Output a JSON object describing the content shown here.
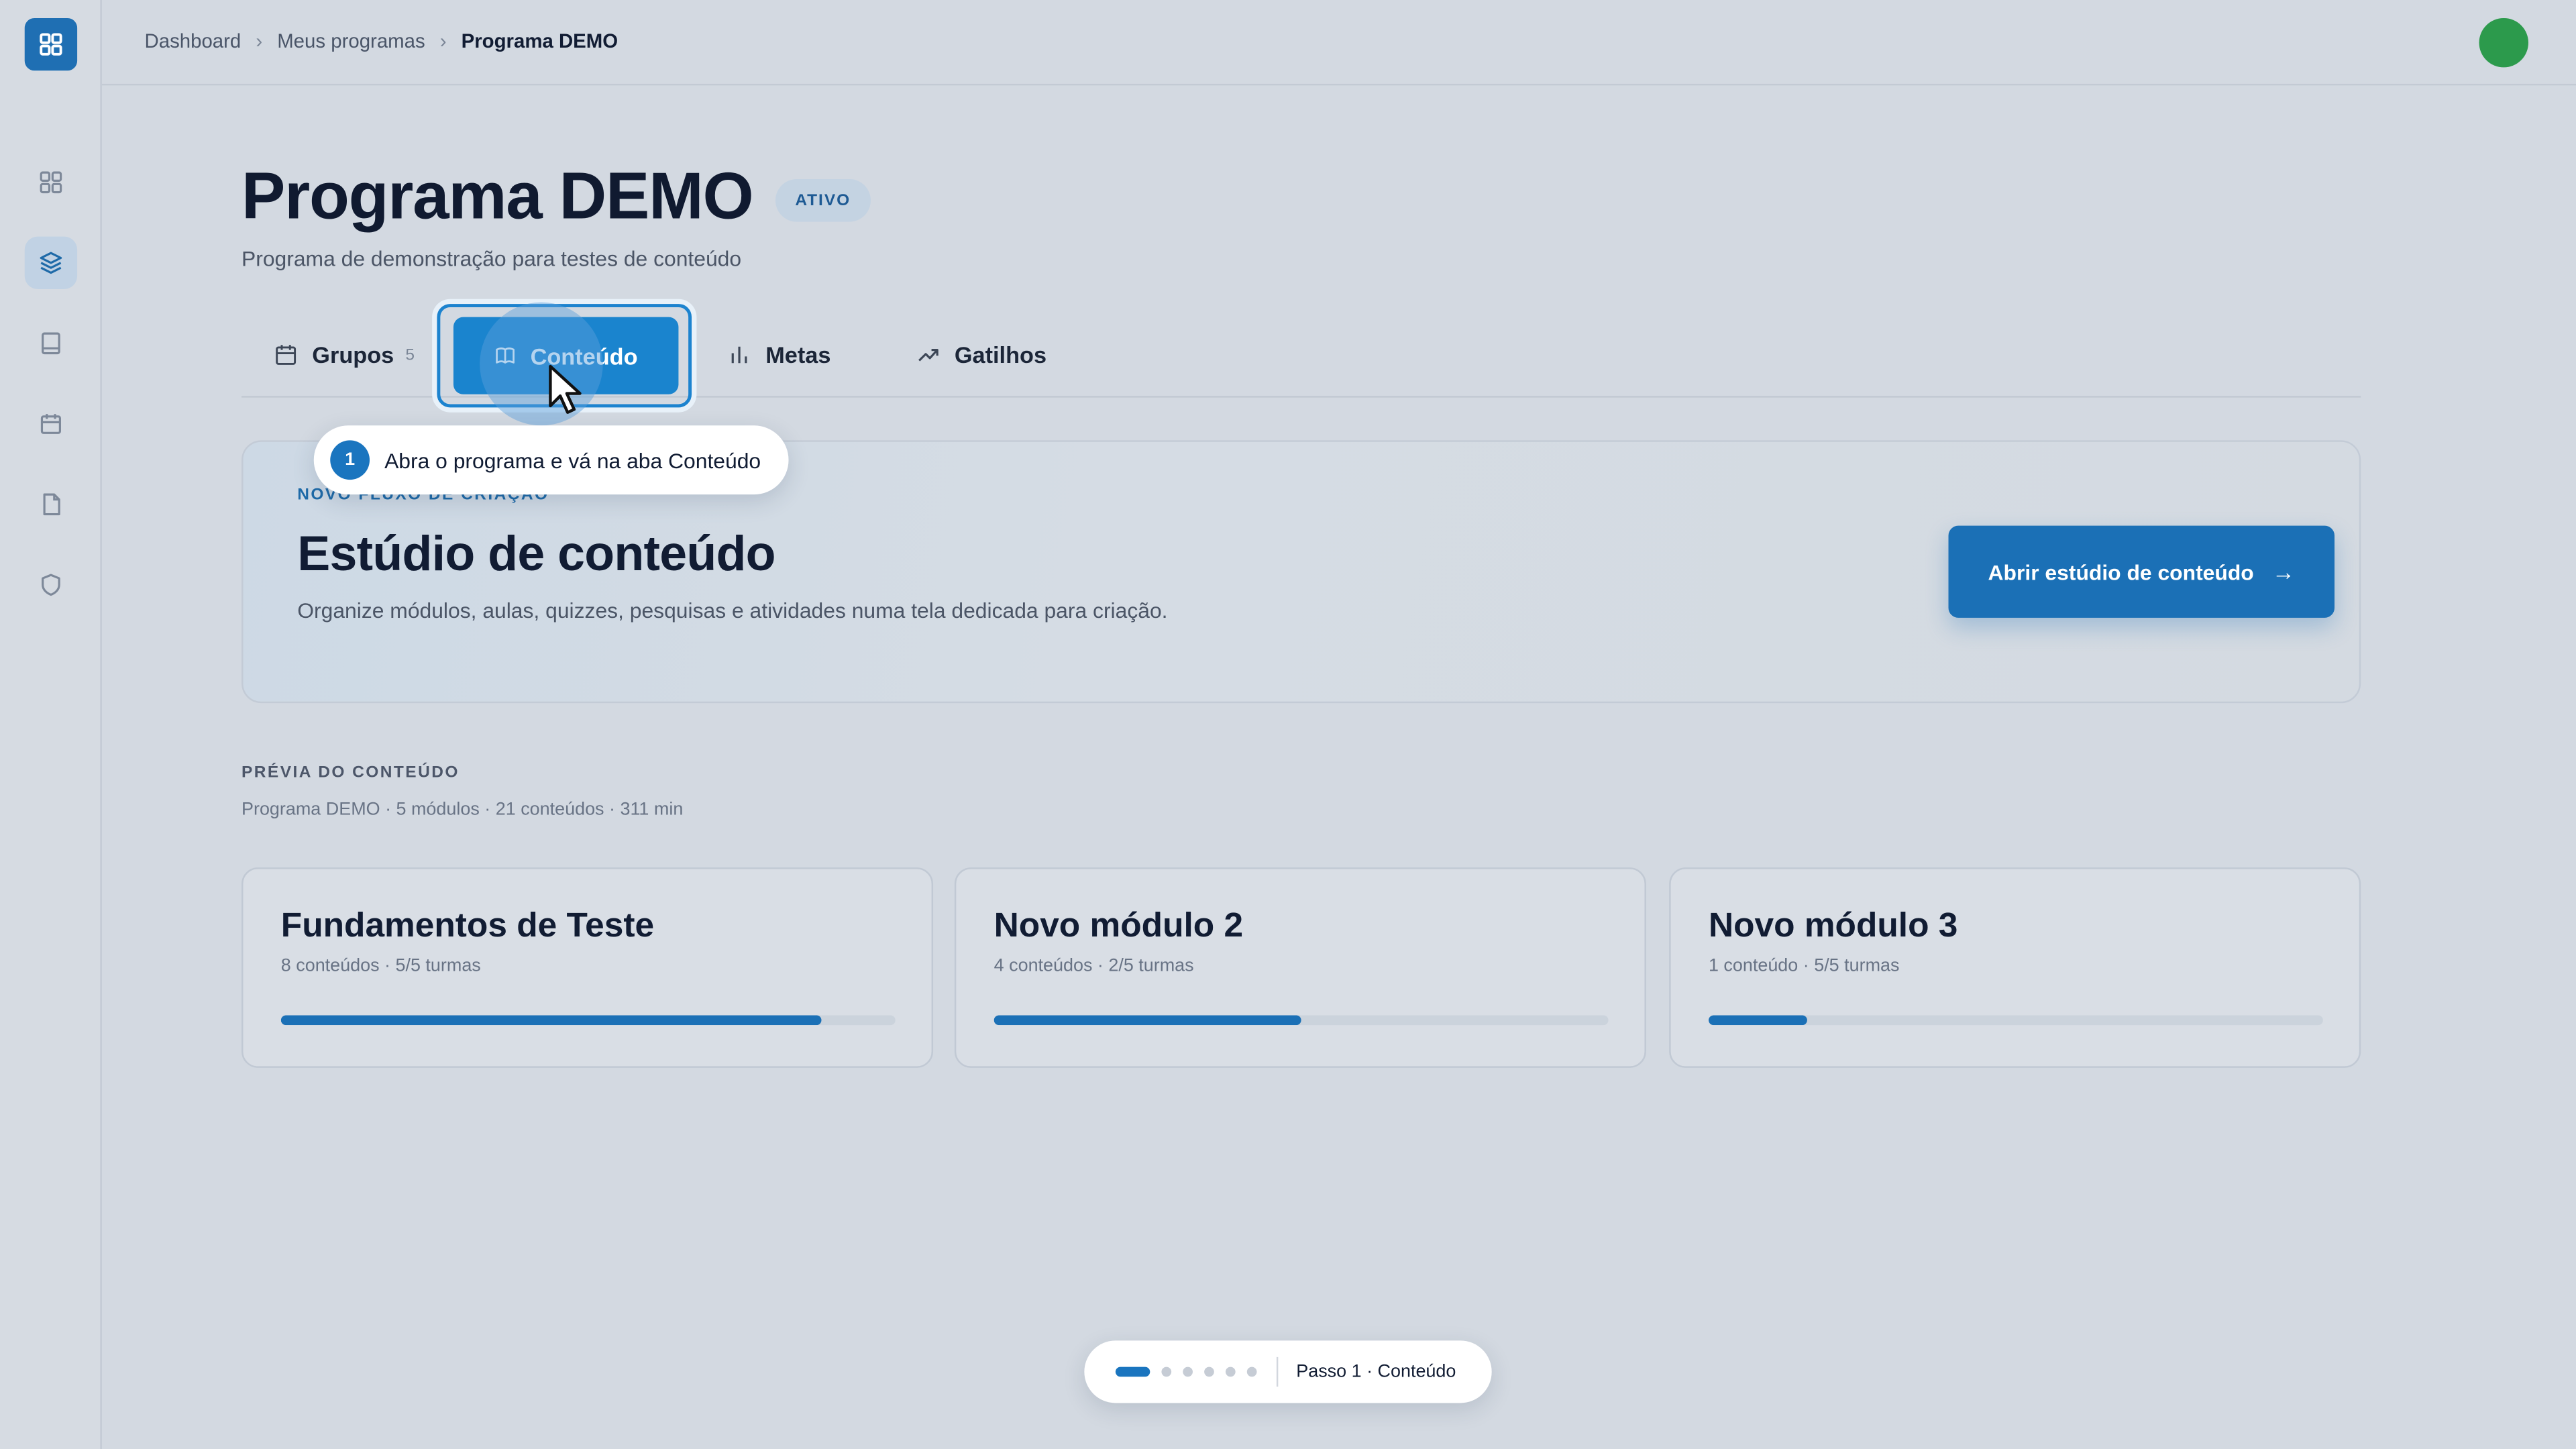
{
  "breadcrumb": {
    "items": [
      "Dashboard",
      "Meus programas"
    ],
    "current": "Programa DEMO",
    "separator": ">"
  },
  "sidebar": {
    "icons": [
      "grid-icon",
      "layers-icon",
      "book-icon",
      "calendar-icon",
      "file-icon",
      "shield-icon"
    ],
    "active": "layers-icon"
  },
  "program": {
    "title": "Programa DEMO",
    "status": "ATIVO",
    "subtitle": "Programa de demonstração para testes de conteúdo"
  },
  "tabs": [
    {
      "label": "Grupos",
      "count": "5",
      "icon": "calendar-icon"
    },
    {
      "label": "Conteúdo",
      "icon": "book-open-icon",
      "active": true
    },
    {
      "label": "Metas",
      "icon": "bar-chart-icon"
    },
    {
      "label": "Gatilhos",
      "icon": "trending-up-icon"
    }
  ],
  "tooltip": {
    "step": "1",
    "text": "Abra o programa e vá na aba Conteúdo"
  },
  "studio": {
    "eyebrow": "NOVO FLUXO DE CRIAÇÃO",
    "title": "Estúdio de conteúdo",
    "description": "Organize módulos, aulas, quizzes, pesquisas e atividades numa tela dedicada para criação.",
    "button_label": "Abrir estúdio de conteúdo",
    "button_arrow": "→"
  },
  "preview": {
    "title": "PRÉVIA DO CONTEÚDO",
    "meta": "Programa DEMO · 5 módulos · 21 conteúdos · 311 min",
    "modules": [
      {
        "title": "Fundamentos de Teste",
        "meta": "8 conteúdos · 5/5 turmas",
        "progress": 0.88
      },
      {
        "title": "Novo módulo 2",
        "meta": "4 conteúdos · 2/5 turmas",
        "progress": 0.5
      },
      {
        "title": "Novo módulo 3",
        "meta": "1 conteúdo · 5/5 turmas",
        "progress": 0.16
      }
    ]
  },
  "stepper": {
    "total_steps": 6,
    "current_step": 1,
    "label": "Passo 1 · Conteúdo"
  },
  "colors": {
    "accent": "#1a84ce",
    "primary_button": "#1b70b6",
    "avatar": "#2c9a4c",
    "background": "#d3d9e1"
  }
}
